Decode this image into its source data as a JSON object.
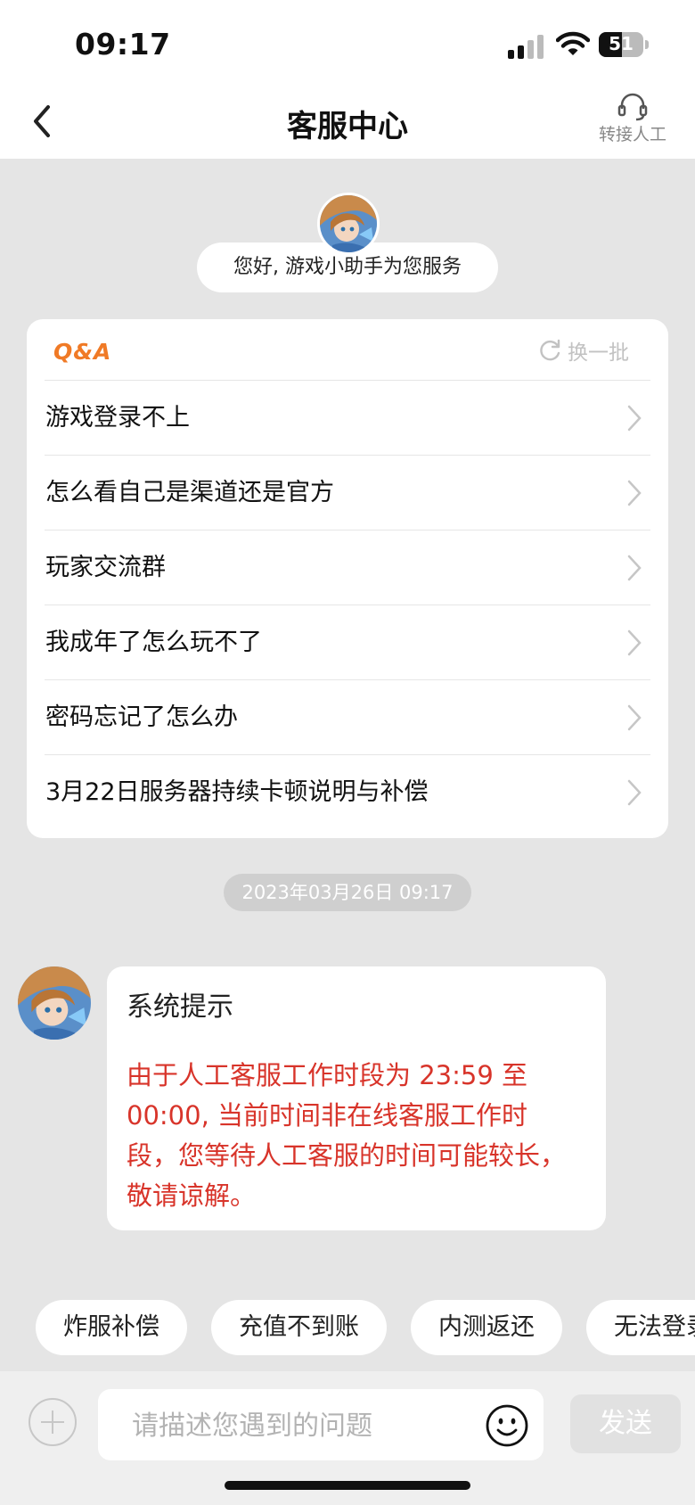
{
  "status_bar": {
    "time": "09:17",
    "battery": "51",
    "battery_level": 0.51
  },
  "nav": {
    "title": "客服中心",
    "agent_label": "转接人工",
    "icons": {
      "back": "chevron-left-icon",
      "agent": "headset-icon"
    }
  },
  "greeting": {
    "text": "您好, 游戏小助手为您服务"
  },
  "qa": {
    "logo": "Q&A",
    "refresh_label": "换一批",
    "items": [
      "游戏登录不上",
      "怎么看自己是渠道还是官方",
      "玩家交流群",
      "我成年了怎么玩不了",
      "密码忘记了怎么办",
      "3月22日服务器持续卡顿说明与补偿"
    ]
  },
  "timestamp": "2023年03月26日 09:17",
  "message": {
    "title": "系统提示",
    "body": "由于人工客服工作时段为 23:59 至 00:00, 当前时间非在线客服工作时段，您等待人工客服的时间可能较长，敬请谅解。"
  },
  "quick_replies": [
    "炸服补偿",
    "充值不到账",
    "内测返还",
    "无法登录"
  ],
  "input": {
    "placeholder": "请描述您遇到的问题",
    "send_label": "发送"
  },
  "colors": {
    "accent_orange": "#f07a26",
    "warning_red": "#d8342a",
    "background": "#e5e5e5"
  }
}
